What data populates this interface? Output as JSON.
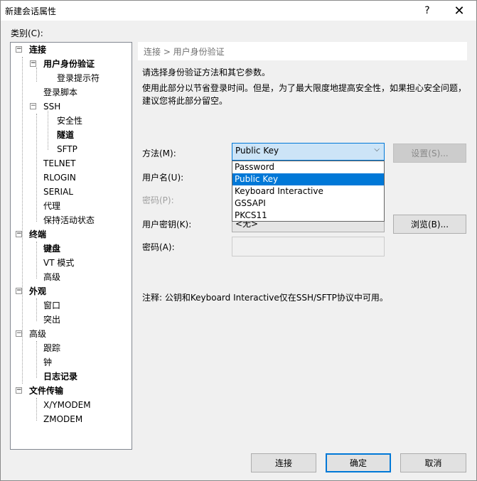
{
  "window": {
    "title": "新建会话属性",
    "help_label": "?",
    "close_label": "✕"
  },
  "category_label": "类别(C):",
  "tree": [
    {
      "label": "连接",
      "bold": true,
      "expander": "−"
    },
    {
      "label": "用户身份验证",
      "bold": true,
      "expander": "−"
    },
    {
      "label": "登录提示符",
      "bold": false
    },
    {
      "label": "登录脚本",
      "bold": false
    },
    {
      "label": "SSH",
      "bold": false,
      "expander": "−"
    },
    {
      "label": "安全性",
      "bold": false
    },
    {
      "label": "隧道",
      "bold": true
    },
    {
      "label": "SFTP",
      "bold": false
    },
    {
      "label": "TELNET",
      "bold": false
    },
    {
      "label": "RLOGIN",
      "bold": false
    },
    {
      "label": "SERIAL",
      "bold": false
    },
    {
      "label": "代理",
      "bold": false
    },
    {
      "label": "保持活动状态",
      "bold": false
    },
    {
      "label": "终端",
      "bold": true,
      "expander": "−"
    },
    {
      "label": "键盘",
      "bold": true
    },
    {
      "label": "VT 模式",
      "bold": false
    },
    {
      "label": "高级",
      "bold": false
    },
    {
      "label": "外观",
      "bold": true,
      "expander": "−"
    },
    {
      "label": "窗口",
      "bold": false
    },
    {
      "label": "突出",
      "bold": false
    },
    {
      "label": "高级",
      "bold": false,
      "expander": "−"
    },
    {
      "label": "跟踪",
      "bold": false
    },
    {
      "label": "钟",
      "bold": false
    },
    {
      "label": "日志记录",
      "bold": true
    },
    {
      "label": "文件传输",
      "bold": true,
      "expander": "−"
    },
    {
      "label": "X/YMODEM",
      "bold": false
    },
    {
      "label": "ZMODEM",
      "bold": false
    }
  ],
  "breadcrumb": "连接 > 用户身份验证",
  "description": {
    "line1": "请选择身份验证方法和其它参数。",
    "line2": "使用此部分以节省登录时间。但是，为了最大限度地提高安全性，如果担心安全问题，",
    "line3": "建议您将此部分留空。"
  },
  "fields": {
    "method_label": "方法(M):",
    "method_value": "Public Key",
    "method_options": [
      "Password",
      "Public Key",
      "Keyboard Interactive",
      "GSSAPI",
      "PKCS11"
    ],
    "method_selected_index": 1,
    "settings_button": "设置(S)...",
    "username_label": "用户名(U):",
    "password_label": "密码(P):",
    "user_key_label": "用户密钥(K):",
    "user_key_value": "<无>",
    "browse_button": "浏览(B)...",
    "passphrase_label": "密码(A):"
  },
  "note": "注释: 公钥和Keyboard Interactive仅在SSH/SFTP协议中可用。",
  "buttons": {
    "connect": "连接",
    "ok": "确定",
    "cancel": "取消"
  }
}
